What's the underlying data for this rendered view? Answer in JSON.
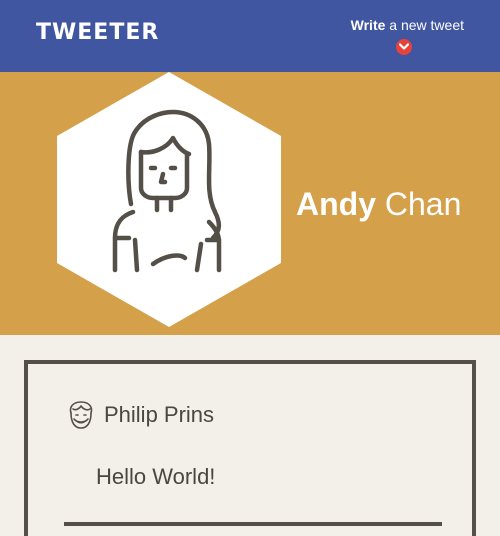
{
  "nav": {
    "brand": "TWEETER",
    "write_bold": "Write",
    "write_rest": " a new tweet"
  },
  "profile": {
    "first_name": "Andy",
    "last_name": " Chan"
  },
  "tweet": {
    "author": "Philip Prins",
    "text": "Hello World!"
  },
  "icons": {
    "toggle": "chevron-down-icon",
    "profile": "avatar-icon",
    "author": "author-avatar-icon"
  },
  "colors": {
    "nav": "#4056a1",
    "banner": "#d4a04a",
    "accent": "#e8433b",
    "page": "#f3efe9",
    "ink": "#544f47"
  }
}
